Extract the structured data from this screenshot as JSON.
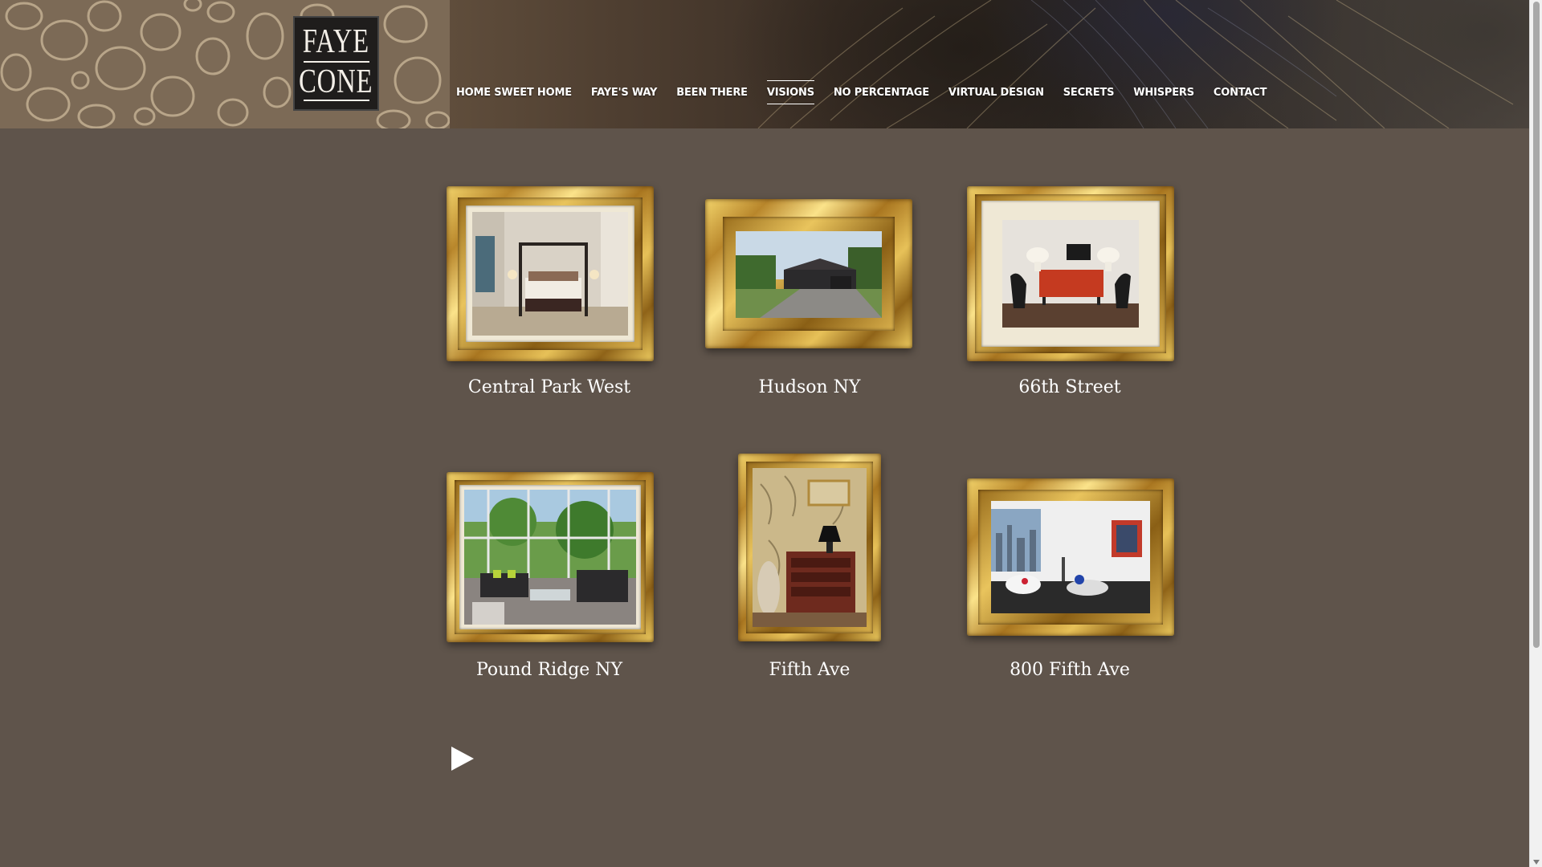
{
  "logo": {
    "line1": "FAYE",
    "line2": "CONE"
  },
  "nav": {
    "items": [
      {
        "label": "HOME SWEET HOME",
        "active": false
      },
      {
        "label": "FAYE'S WAY",
        "active": false
      },
      {
        "label": "BEEN THERE",
        "active": false
      },
      {
        "label": "VISIONS",
        "active": true
      },
      {
        "label": "NO PERCENTAGE",
        "active": false
      },
      {
        "label": "VIRTUAL DESIGN",
        "active": false
      },
      {
        "label": "SECRETS",
        "active": false
      },
      {
        "label": "WHISPERS",
        "active": false
      },
      {
        "label": "CONTACT",
        "active": false
      }
    ]
  },
  "gallery": {
    "projects": [
      {
        "title": "Central Park West"
      },
      {
        "title": "Hudson NY"
      },
      {
        "title": "66th Street"
      },
      {
        "title": "Pound Ridge NY"
      },
      {
        "title": "Fifth Ave"
      },
      {
        "title": "800 Fifth Ave"
      }
    ]
  },
  "colors": {
    "page_background": "#5f544b",
    "gold_frame": "#d8b04c",
    "text": "#ffffff"
  },
  "icons": {
    "play": "play-icon"
  }
}
